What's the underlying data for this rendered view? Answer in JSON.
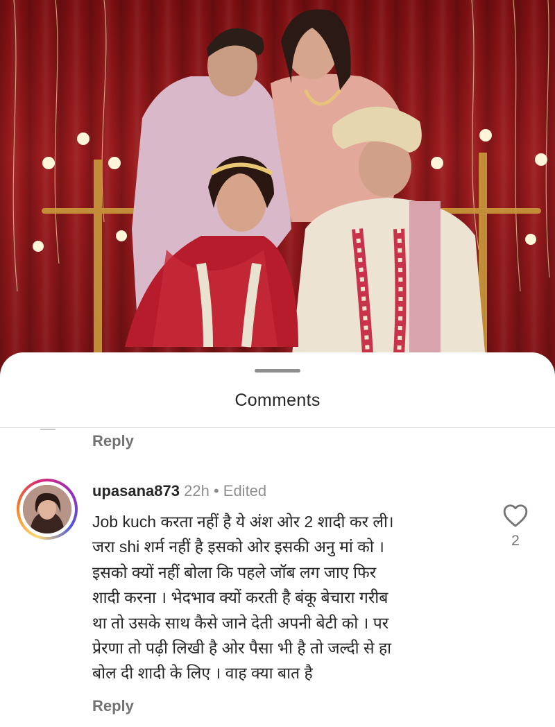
{
  "sheet": {
    "title": "Comments"
  },
  "previous_comment": {
    "reply_label": "Reply"
  },
  "comment": {
    "username": "upasana873",
    "time": "22h",
    "separator": "•",
    "edited": "Edited",
    "lines": [
      "Job kuch करता नहीं है ये अंश ओर 2 शादी कर ली।",
      "जरा shi शर्म नहीं है इसको ओर इसकी अनु मां को ।",
      "इसको क्यों नहीं बोला कि पहले जॉब लग जाए फिर",
      "शादी करना । भेदभाव क्यों करती है बंकू बेचारा गरीब",
      "था तो उसके साथ कैसे जाने देती अपनी बेटी को । पर",
      "प्रेरणा तो पढ़ी लिखी है ओर पैसा भी है तो जल्दी से हा",
      "बोल दी शादी के लिए । वाह क्या बात है"
    ],
    "like_count": "2",
    "reply_label": "Reply",
    "like_icon": "heart-outline-icon"
  },
  "colors": {
    "text_primary": "#262626",
    "text_secondary": "#737373",
    "divider": "#dbdbdb",
    "curtain_red": "#9a1b1d"
  }
}
